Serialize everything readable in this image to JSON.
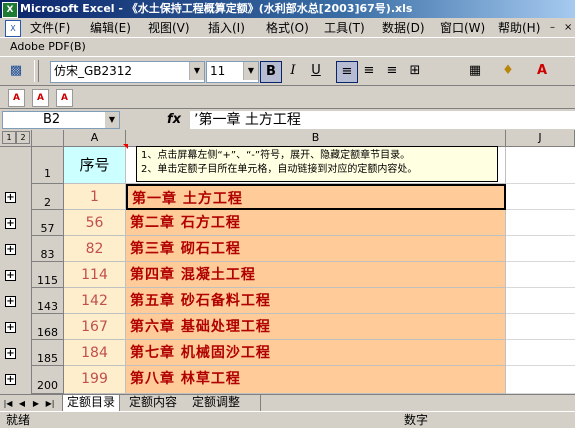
{
  "window": {
    "title": "Microsoft Excel - 《水土保持工程概算定额》(水利部水总[2003]67号).xls"
  },
  "menu": [
    {
      "label": "文件(F)"
    },
    {
      "label": "编辑(E)"
    },
    {
      "label": "视图(V)"
    },
    {
      "label": "插入(I)"
    },
    {
      "label": "格式(O)"
    },
    {
      "label": "工具(T)"
    },
    {
      "label": "数据(D)"
    },
    {
      "label": "窗口(W)"
    },
    {
      "label": "帮助(H)"
    }
  ],
  "adobe_menu": "Adobe PDF(B)",
  "toolbar": {
    "font_name": "仿宋_GB2312",
    "font_size": "11",
    "bold": "B",
    "italic": "I",
    "underline": "U"
  },
  "formula_bar": {
    "name_box": "B2",
    "fx": "fx",
    "content": "’第一章 土方工程"
  },
  "sheet": {
    "outline_levels": [
      "1",
      "2"
    ],
    "columns": [
      "A",
      "B",
      "J"
    ],
    "header_row": {
      "row": "1",
      "a": "序号"
    },
    "note_lines": [
      "1、点击屏幕左侧“+”、“-”符号，展开、隐藏定额章节目录。",
      "2、单击定额子目所在单元格，自动链接到对应的定额内容处。"
    ],
    "rows": [
      {
        "row": "2",
        "a": "1",
        "b": "第一章 土方工程"
      },
      {
        "row": "57",
        "a": "56",
        "b": "第二章 石方工程"
      },
      {
        "row": "83",
        "a": "82",
        "b": "第三章 砌石工程"
      },
      {
        "row": "115",
        "a": "114",
        "b": "第四章 混凝土工程"
      },
      {
        "row": "143",
        "a": "142",
        "b": "第五章 砂石备料工程"
      },
      {
        "row": "168",
        "a": "167",
        "b": "第六章 基础处理工程"
      },
      {
        "row": "185",
        "a": "184",
        "b": "第七章 机械固沙工程"
      },
      {
        "row": "200",
        "a": "199",
        "b": "第八章 林草工程"
      }
    ]
  },
  "tabs": [
    {
      "label": "定额目录"
    },
    {
      "label": "定额内容"
    },
    {
      "label": "定额调整"
    }
  ],
  "status": {
    "left": "就绪",
    "right": "数字"
  }
}
